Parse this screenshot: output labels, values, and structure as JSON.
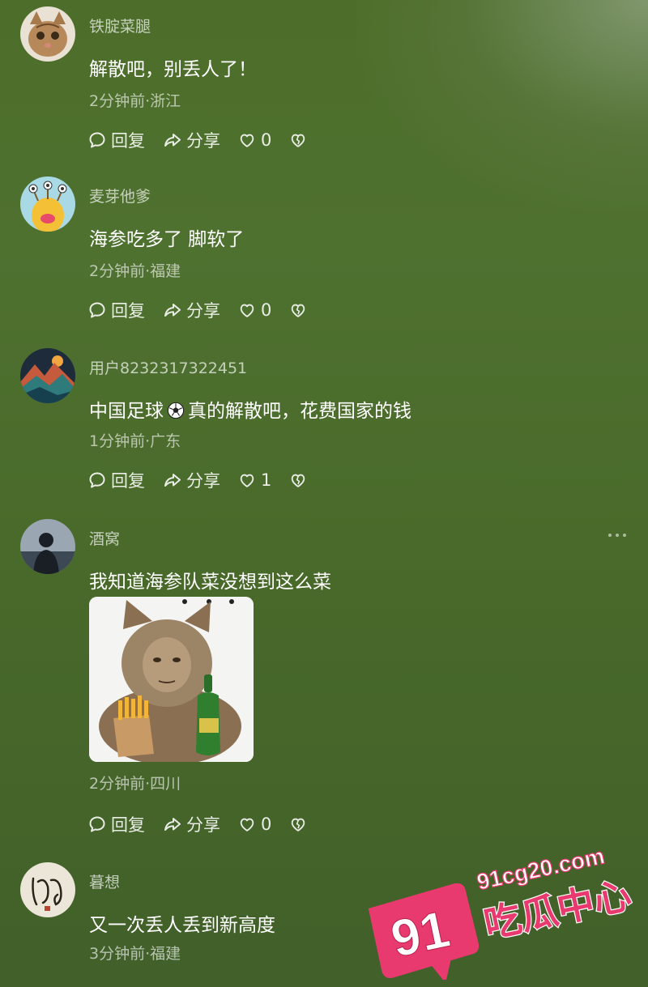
{
  "comments": [
    {
      "username": "铁腚菜腿",
      "text": "解散吧，别丢人了！",
      "meta": "2分钟前·浙江",
      "reply_label": "回复",
      "share_label": "分享",
      "likes": "0"
    },
    {
      "username": "麦芽他爹",
      "text": "海参吃多了 脚软了",
      "meta": "2分钟前·福建",
      "reply_label": "回复",
      "share_label": "分享",
      "likes": "0"
    },
    {
      "username": "用户8232317322451",
      "text_before": "中国足球",
      "text_after": "真的解散吧，花费国家的钱",
      "meta": "1分钟前·广东",
      "reply_label": "回复",
      "share_label": "分享",
      "likes": "1"
    },
    {
      "username": "酒窝",
      "text": "我知道海参队菜没想到这么菜",
      "meta": "2分钟前·四川",
      "reply_label": "回复",
      "share_label": "分享",
      "likes": "0"
    },
    {
      "username": "暮想",
      "text": "又一次丢人丢到新高度",
      "meta": "3分钟前·福建"
    }
  ],
  "watermark": {
    "number": "91",
    "domain": "91cg20.com",
    "name": "吃瓜中心"
  },
  "colors": {
    "background": "#4d6e2a",
    "watermark_pink": "#e83a6e"
  }
}
